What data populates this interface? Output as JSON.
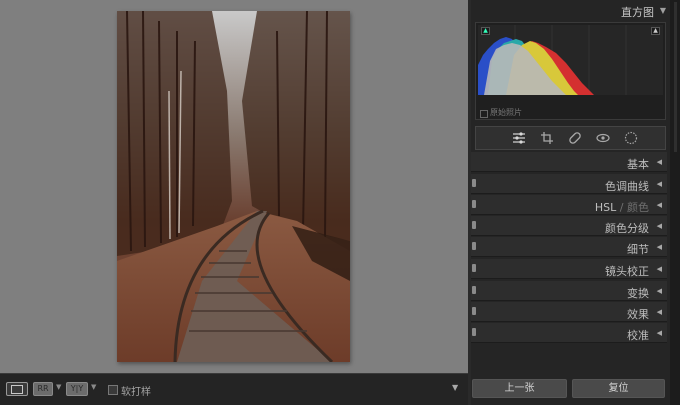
{
  "right_panel": {
    "histogram": {
      "title": "直方图",
      "original_photo_label": "原始照片"
    },
    "sections": [
      {
        "label": "基本",
        "has_toggle": false
      },
      {
        "label": "色调曲线",
        "has_toggle": true
      },
      {
        "label_main": "HSL",
        "label_sep": " / ",
        "label_dim": "颜色",
        "has_toggle": true
      },
      {
        "label": "颜色分级",
        "has_toggle": true
      },
      {
        "label": "细节",
        "has_toggle": true
      },
      {
        "label": "镜头校正",
        "has_toggle": true
      },
      {
        "label": "变换",
        "has_toggle": true
      },
      {
        "label": "效果",
        "has_toggle": true
      },
      {
        "label": "校准",
        "has_toggle": true
      }
    ],
    "tools": [
      "sliders-icon",
      "crop-icon",
      "healing-icon",
      "redeye-icon",
      "masking-icon"
    ],
    "buttons": {
      "previous": "上一张",
      "reset": "复位"
    }
  },
  "bottom_toolbar": {
    "view_loupe_label": "",
    "view_compare_label": "RR",
    "view_yy_label": "Y|Y",
    "soft_proof_label": "软打样"
  },
  "colors": {
    "canvas_bg": "#7f7f7f",
    "panel_bg": "#252525",
    "accent_teal": "#3fb"
  }
}
